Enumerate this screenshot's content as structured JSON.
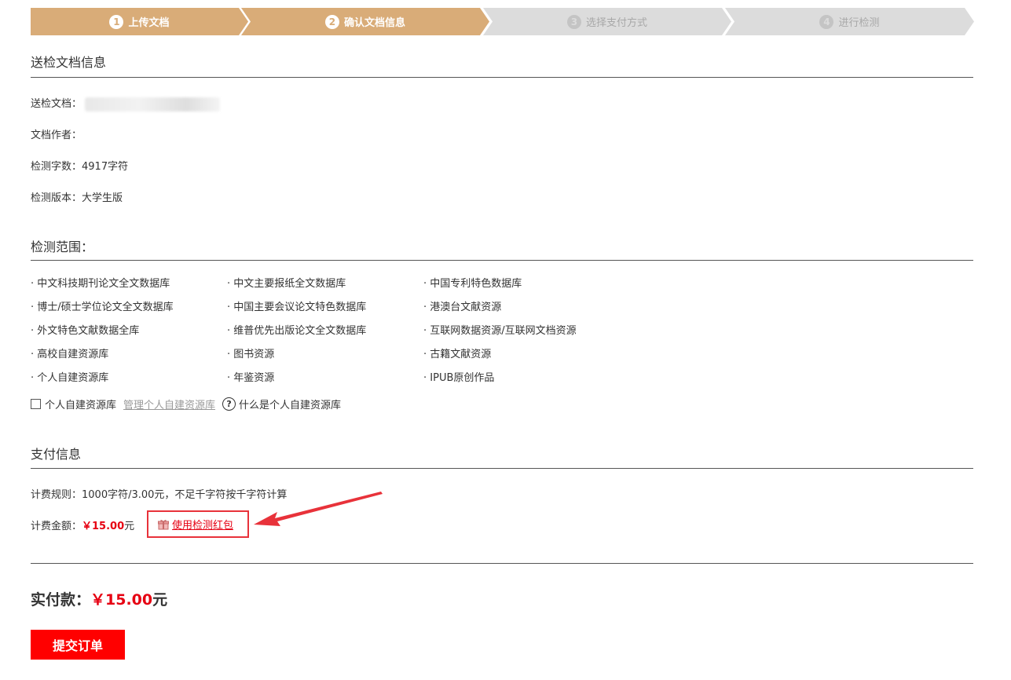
{
  "steps": [
    {
      "num": "1",
      "label": "上传文档",
      "state": "done"
    },
    {
      "num": "2",
      "label": "确认文档信息",
      "state": "done"
    },
    {
      "num": "3",
      "label": "选择支付方式",
      "state": "todo"
    },
    {
      "num": "4",
      "label": "进行检测",
      "state": "todo"
    }
  ],
  "doc_info": {
    "title": "送检文档信息",
    "doc_label": "送检文档：",
    "author_label": "文档作者：",
    "word_count": "检测字数：4917字符",
    "version": "检测版本：大学生版"
  },
  "scope": {
    "title": "检测范围：",
    "items": [
      "· 中文科技期刊论文全文数据库",
      "· 中文主要报纸全文数据库",
      "· 中国专利特色数据库",
      "· 博士/硕士学位论文全文数据库",
      "· 中国主要会议论文特色数据库",
      "· 港澳台文献资源",
      "· 外文特色文献数据全库",
      "· 维普优先出版论文全文数据库",
      "· 互联网数据资源/互联网文档资源",
      "· 高校自建资源库",
      "· 图书资源",
      "· 古籍文献资源",
      "· 个人自建资源库",
      "· 年鉴资源",
      "· IPUB原创作品"
    ],
    "personal_checkbox_label": "个人自建资源库",
    "manage_link": "管理个人自建资源库",
    "help_text": "什么是个人自建资源库"
  },
  "payment": {
    "title": "支付信息",
    "rule": "计费规则：1000字符/3.00元，不足千字符按千字符计算",
    "amount_label": "计费金额：",
    "amount_value": "￥15.00",
    "amount_unit": "元",
    "coupon_link": "使用检测红包"
  },
  "total": {
    "label": "实付款：",
    "value": "￥15.00",
    "unit": "元"
  },
  "submit_label": "提交订单",
  "colors": {
    "step_done": "#d9ac78",
    "step_todo": "#dcdcdc",
    "accent_red": "#e60012",
    "button_red": "#ff0000"
  }
}
